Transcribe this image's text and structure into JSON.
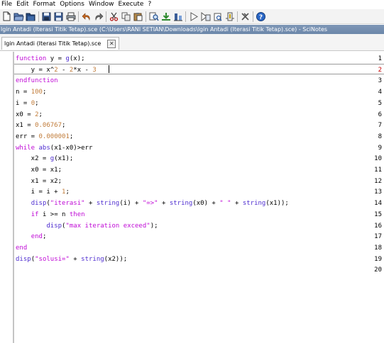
{
  "menu": [
    "File",
    "Edit",
    "Format",
    "Options",
    "Window",
    "Execute",
    "?"
  ],
  "toolbar": [
    "new-file-icon",
    "open-folder-icon",
    "open-file-icon",
    "save-icon",
    "save-as-icon",
    "print-icon",
    "undo-icon",
    "redo-icon",
    "cut-icon",
    "copy-icon",
    "paste-icon",
    "search-replace-icon",
    "execute-icon",
    "load-icon",
    "run-icon",
    "next-icon",
    "step-icon",
    "debug-icon",
    "tools-icon",
    "help-icon"
  ],
  "title": "lgin Antadi (Iterasi Titik Tetap).sce (C:\\Users\\RANI SETIAN\\Downloads\\lgin Antadi (Iterasi Titik Tetap).sce) - SciNotes",
  "tab": {
    "label": "lgin Antadi (Iterasi Titik Tetap).sce",
    "close": "✕"
  },
  "editor": {
    "current_line": 2,
    "lines": [
      {
        "n": "1",
        "text": "function y = g(x);"
      },
      {
        "n": "2",
        "text": "    y = x^2 - 2*x - 3"
      },
      {
        "n": "3",
        "text": "endfunction"
      },
      {
        "n": "4",
        "text": "n = 100;"
      },
      {
        "n": "5",
        "text": "i = 0;"
      },
      {
        "n": "6",
        "text": "x0 = 2;"
      },
      {
        "n": "7",
        "text": "x1 = 0.06767;"
      },
      {
        "n": "8",
        "text": "err = 0.000001;"
      },
      {
        "n": "9",
        "text": "while abs(x1-x0)>err"
      },
      {
        "n": "10",
        "text": "    x2 = g(x1);"
      },
      {
        "n": "11",
        "text": "    x0 = x1;"
      },
      {
        "n": "12",
        "text": "    x1 = x2;"
      },
      {
        "n": "13",
        "text": "    i = i + 1;"
      },
      {
        "n": "14",
        "text": "    disp(\"iterasi\" + string(i) + \"=>\" + string(x0) + \" \" + string(x1));"
      },
      {
        "n": "15",
        "text": "    if i >= n then"
      },
      {
        "n": "16",
        "text": "        disp(\"max iteration exceed\");"
      },
      {
        "n": "17",
        "text": "    end;"
      },
      {
        "n": "18",
        "text": "end"
      },
      {
        "n": "19",
        "text": "disp(\"solusi=\" + string(x2));"
      },
      {
        "n": "20",
        "text": ""
      }
    ]
  }
}
